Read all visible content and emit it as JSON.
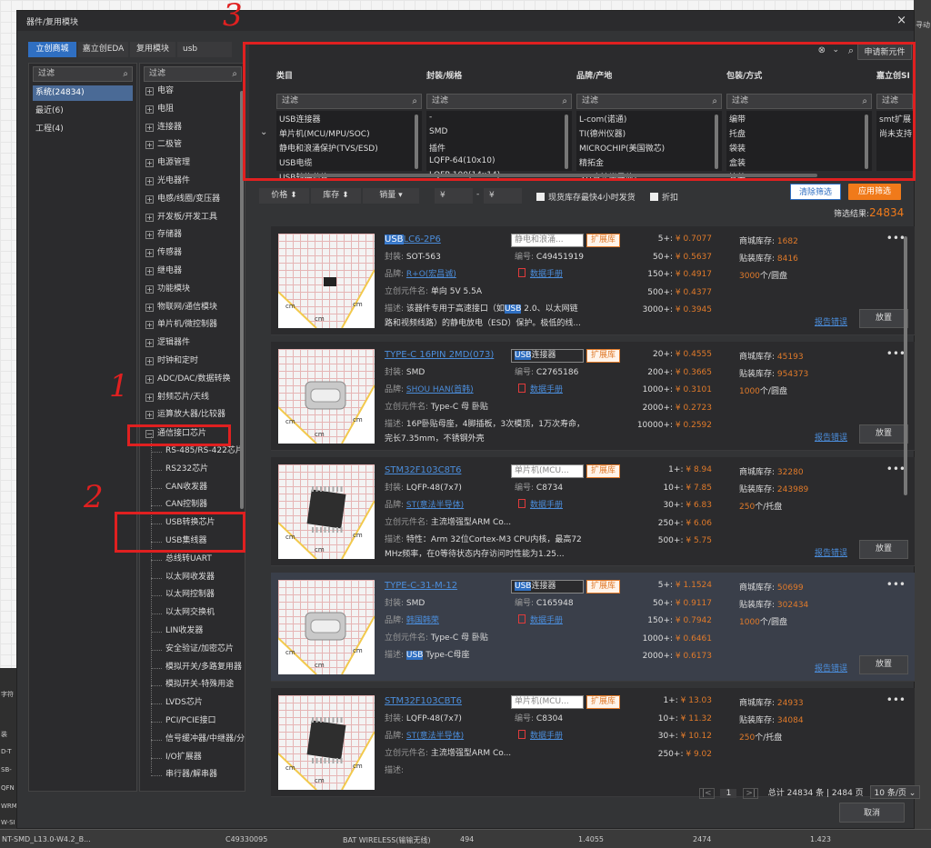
{
  "dialog": {
    "title": "器件/复用模块",
    "close": "×",
    "tabs": [
      "立创商城",
      "嘉立创EDA",
      "复用模块",
      "usb"
    ]
  },
  "left_panel": {
    "filter_placeholder": "过滤",
    "items": [
      {
        "label": "系统(24834)",
        "selected": true
      },
      {
        "label": "最近(6)",
        "selected": false
      },
      {
        "label": "工程(4)",
        "selected": false
      }
    ]
  },
  "tree_panel": {
    "filter_placeholder": "过滤",
    "categories": [
      "电容",
      "电阻",
      "连接器",
      "二极管",
      "电源管理",
      "光电器件",
      "电感/线圈/变压器",
      "开发板/开发工具",
      "存储器",
      "传感器",
      "继电器",
      "功能模块",
      "物联网/通信模块",
      "单片机/微控制器",
      "逻辑器件",
      "时钟和定时",
      "ADC/DAC/数据转换",
      "射频芯片/天线",
      "运算放大器/比较器"
    ],
    "expanded": "通信接口芯片",
    "children": [
      "RS-485/RS-422芯片",
      "RS232芯片",
      "CAN收发器",
      "CAN控制器",
      "USB转换芯片",
      "USB集线器",
      "总线转UART",
      "以太网收发器",
      "以太网控制器",
      "以太网交换机",
      "LIN收发器",
      "安全验证/加密芯片",
      "模拟开关/多路复用器",
      "模拟开关-特殊用途",
      "LVDS芯片",
      "PCI/PCIE接口",
      "信号缓冲器/中继器/分",
      "I/O扩展器",
      "串行器/解串器"
    ]
  },
  "filter_panel": {
    "apply_new": "申请新元件",
    "search_clear": "⊗",
    "columns": [
      {
        "header": "类目",
        "placeholder": "过滤",
        "options": [
          "USB连接器",
          "单片机(MCU/MPU/SOC)",
          "静电和浪涌保护(TVS/ESD)",
          "USB电缆",
          "USB转换芯片"
        ]
      },
      {
        "header": "封装/规格",
        "placeholder": "过滤",
        "options": [
          "-",
          "SMD",
          "插件",
          "LQFP-64(10x10)",
          "LQFP-100(14x14)"
        ]
      },
      {
        "header": "品牌/产地",
        "placeholder": "过滤",
        "options": [
          "L-com(诺通)",
          "TI(德州仪器)",
          "MICROCHIP(美国微芯)",
          "精拓金",
          "ST(意法半导体)"
        ]
      },
      {
        "header": "包装/方式",
        "placeholder": "过滤",
        "options": [
          "编带",
          "托盘",
          "袋装",
          "盒装",
          "管装"
        ]
      },
      {
        "header": "嘉立创SI",
        "placeholder": "过滤",
        "options": [
          "smt扩展",
          "尚未支持"
        ]
      }
    ]
  },
  "actions": {
    "clear": "清除筛选",
    "apply": "应用筛选",
    "result_label": "筛选结果:",
    "result_count": "24834"
  },
  "sort_bar": {
    "price": "价格",
    "stock": "库存",
    "sales": "销量",
    "price_min": "¥",
    "price_max": "¥",
    "dash": "-",
    "fast_ship": "现货库存最快4小时发货",
    "discount": "折扣"
  },
  "labels": {
    "package": "封装:",
    "code": "编号:",
    "brand": "品牌:",
    "component": "立创元件名:",
    "desc": "描述:",
    "datasheet": "数据手册",
    "mall_stock": "商城库存:",
    "smt_stock": "贴装库存:",
    "report": "报告错误",
    "place": "放置",
    "ext": "扩展库"
  },
  "products": [
    {
      "name_hl": "USB",
      "name_rest": "LC6-2P6",
      "category": "静电和浪涌...",
      "package": "SOT-563",
      "code": "C49451919",
      "brand": "R+O(宏昌诚)",
      "component": "单向 5V 5.5A",
      "desc_pre": "该器件专用于高速接口（如",
      "desc_hl": "USB",
      "desc_post": " 2.0、以太网链",
      "desc2": "路和视频线路）的静电放电（ESD）保护。极低的线...",
      "prices": [
        [
          "5+:",
          "¥ 0.7077"
        ],
        [
          "50+:",
          "¥ 0.5637"
        ],
        [
          "150+:",
          "¥ 0.4917"
        ],
        [
          "500+:",
          "¥ 0.4377"
        ],
        [
          "3000+:",
          "¥ 0.3945"
        ]
      ],
      "mall_stock": "1682",
      "smt_stock": "8416",
      "reel": "3000",
      "reel_unit": "个/圆盘",
      "chip": "sot"
    },
    {
      "name_hl": "",
      "name_rest": "TYPE-C 16PIN 2MD(073)",
      "category_hl": "USB",
      "category": "连接器",
      "package": "SMD",
      "code": "C2765186",
      "brand": "SHOU HAN(首韩)",
      "component": "Type-C 母 卧贴",
      "desc_pre": "16P卧贴母座，4脚插板，3次模顶，1万次寿命，",
      "desc_hl": "",
      "desc_post": "",
      "desc2": "完长7.35mm，不锈钢外壳",
      "prices": [
        [
          "20+:",
          "¥ 0.4555"
        ],
        [
          "200+:",
          "¥ 0.3665"
        ],
        [
          "1000+:",
          "¥ 0.3101"
        ],
        [
          "2000+:",
          "¥ 0.2723"
        ],
        [
          "10000+:",
          "¥ 0.2592"
        ]
      ],
      "mall_stock": "45193",
      "smt_stock": "954373",
      "reel": "1000",
      "reel_unit": "个/圆盘",
      "chip": "typec"
    },
    {
      "name_hl": "",
      "name_rest": "STM32F103C8T6",
      "category": "单片机(MCU...",
      "package": "LQFP-48(7x7)",
      "code": "C8734",
      "brand": "ST(意法半导体)",
      "component": "主流增强型ARM Co...",
      "desc_pre": "特性：Arm 32位Cortex-M3 CPU内核，最高72",
      "desc_hl": "",
      "desc_post": "",
      "desc2": "MHz频率，在0等待状态内存访问时性能为1.25...",
      "prices": [
        [
          "1+:",
          "¥ 8.94"
        ],
        [
          "10+:",
          "¥ 7.85"
        ],
        [
          "30+:",
          "¥ 6.83"
        ],
        [
          "250+:",
          "¥ 6.06"
        ],
        [
          "500+:",
          "¥ 5.75"
        ]
      ],
      "mall_stock": "32280",
      "smt_stock": "243989",
      "reel": "250",
      "reel_unit": "个/托盘",
      "chip": "lqfp"
    },
    {
      "name_hl": "",
      "name_rest": "TYPE-C-31-M-12",
      "category_hl": "USB",
      "category": "连接器",
      "package": "SMD",
      "code": "C165948",
      "brand": "韩国韩荣",
      "component": "Type-C 母 卧贴",
      "desc_pre": "",
      "desc_hl": "USB",
      "desc_post": " Type-C母座",
      "desc2": "",
      "prices": [
        [
          "5+:",
          "¥ 1.1524"
        ],
        [
          "50+:",
          "¥ 0.9117"
        ],
        [
          "150+:",
          "¥ 0.7942"
        ],
        [
          "1000+:",
          "¥ 0.6461"
        ],
        [
          "2000+:",
          "¥ 0.6173"
        ]
      ],
      "mall_stock": "50699",
      "smt_stock": "302434",
      "reel": "1000",
      "reel_unit": "个/圆盘",
      "chip": "typec"
    },
    {
      "name_hl": "",
      "name_rest": "STM32F103CBT6",
      "category": "单片机(MCU...",
      "package": "LQFP-48(7x7)",
      "code": "C8304",
      "brand": "ST(意法半导体)",
      "component": "主流增强型ARM Co...",
      "desc_pre": "",
      "desc_hl": "",
      "desc_post": "",
      "desc2": "",
      "prices": [
        [
          "1+:",
          "¥ 13.03"
        ],
        [
          "10+:",
          "¥ 11.32"
        ],
        [
          "30+:",
          "¥ 10.12"
        ],
        [
          "250+:",
          "¥ 9.02"
        ]
      ],
      "mall_stock": "24933",
      "smt_stock": "34084",
      "reel": "250",
      "reel_unit": "个/托盘",
      "chip": "lqfp"
    }
  ],
  "pagination": {
    "page": "1",
    "total": "总计 24834 条 | 2484 页",
    "per_page": "10 条/页"
  },
  "footer": {
    "cancel": "取消"
  },
  "annotations": [
    "1",
    "2",
    "3"
  ],
  "background": {
    "bottom_row": [
      "NT-SMD_L13.0-W4.2_B...",
      "C49330095",
      "BAT WIRELESS(输输无线)",
      "494",
      "1.4055",
      "2474",
      "1.423"
    ],
    "right_labels": [
      "寻动"
    ],
    "left_labels": [
      "字符",
      "装",
      "D-T",
      "SB-",
      "QFN",
      "WRM",
      "W-SI"
    ]
  }
}
